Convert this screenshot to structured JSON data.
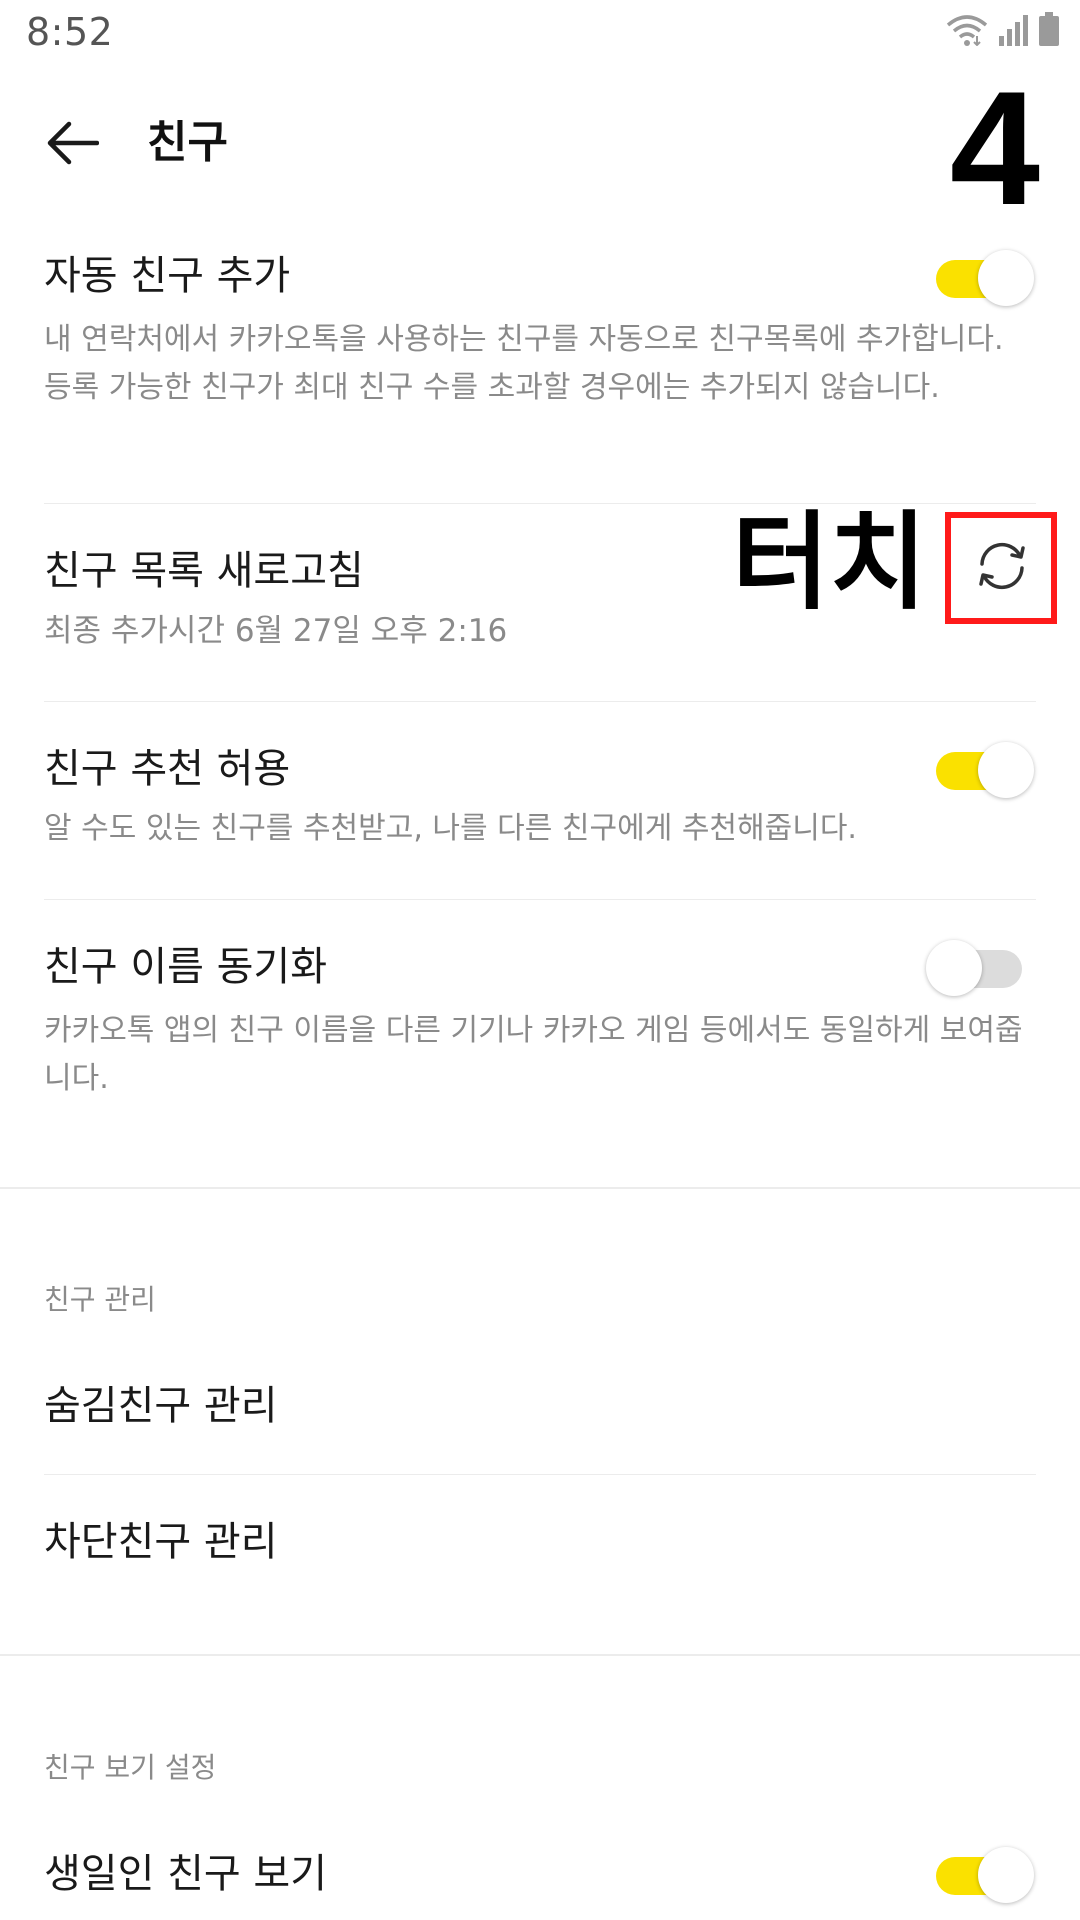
{
  "status_bar": {
    "time": "8:52",
    "icons": [
      "wifi-icon",
      "signal-icon",
      "battery-icon"
    ]
  },
  "app_bar": {
    "title": "친구",
    "back_icon": "arrow-left-icon"
  },
  "annotation": {
    "step_number": "4",
    "touch_label": "터치",
    "highlight_color": "#ff1a1a"
  },
  "settings": {
    "auto_add": {
      "title": "자동 친구 추가",
      "description": "내 연락처에서 카카오톡을 사용하는 친구를 자동으로 친구목록에 추가합니다. 등록 가능한 친구가 최대 친구 수를 초과할 경우에는 추가되지 않습니다.",
      "enabled": true
    },
    "refresh": {
      "title": "친구 목록 새로고침",
      "description": "최종 추가시간 6월 27일 오후 2:16",
      "icon": "refresh-icon"
    },
    "recommend": {
      "title": "친구 추천 허용",
      "description": "알 수도 있는 친구를 추천받고, 나를 다른 친구에게 추천해줍니다.",
      "enabled": true
    },
    "name_sync": {
      "title": "친구 이름 동기화",
      "description": "카카오톡 앱의 친구 이름을 다른 기기나 카카오 게임 등에서도 동일하게 보여줍니다.",
      "enabled": false
    }
  },
  "manage_section": {
    "header": "친구 관리",
    "items": [
      {
        "label": "숨김친구 관리"
      },
      {
        "label": "차단친구 관리"
      }
    ]
  },
  "view_section": {
    "header": "친구 보기 설정",
    "birthday": {
      "title": "생일인 친구 보기",
      "enabled": true
    }
  },
  "colors": {
    "toggle_on": "#fae100",
    "toggle_off": "#dcdcdc",
    "secondary_text": "#8a8a8a"
  }
}
